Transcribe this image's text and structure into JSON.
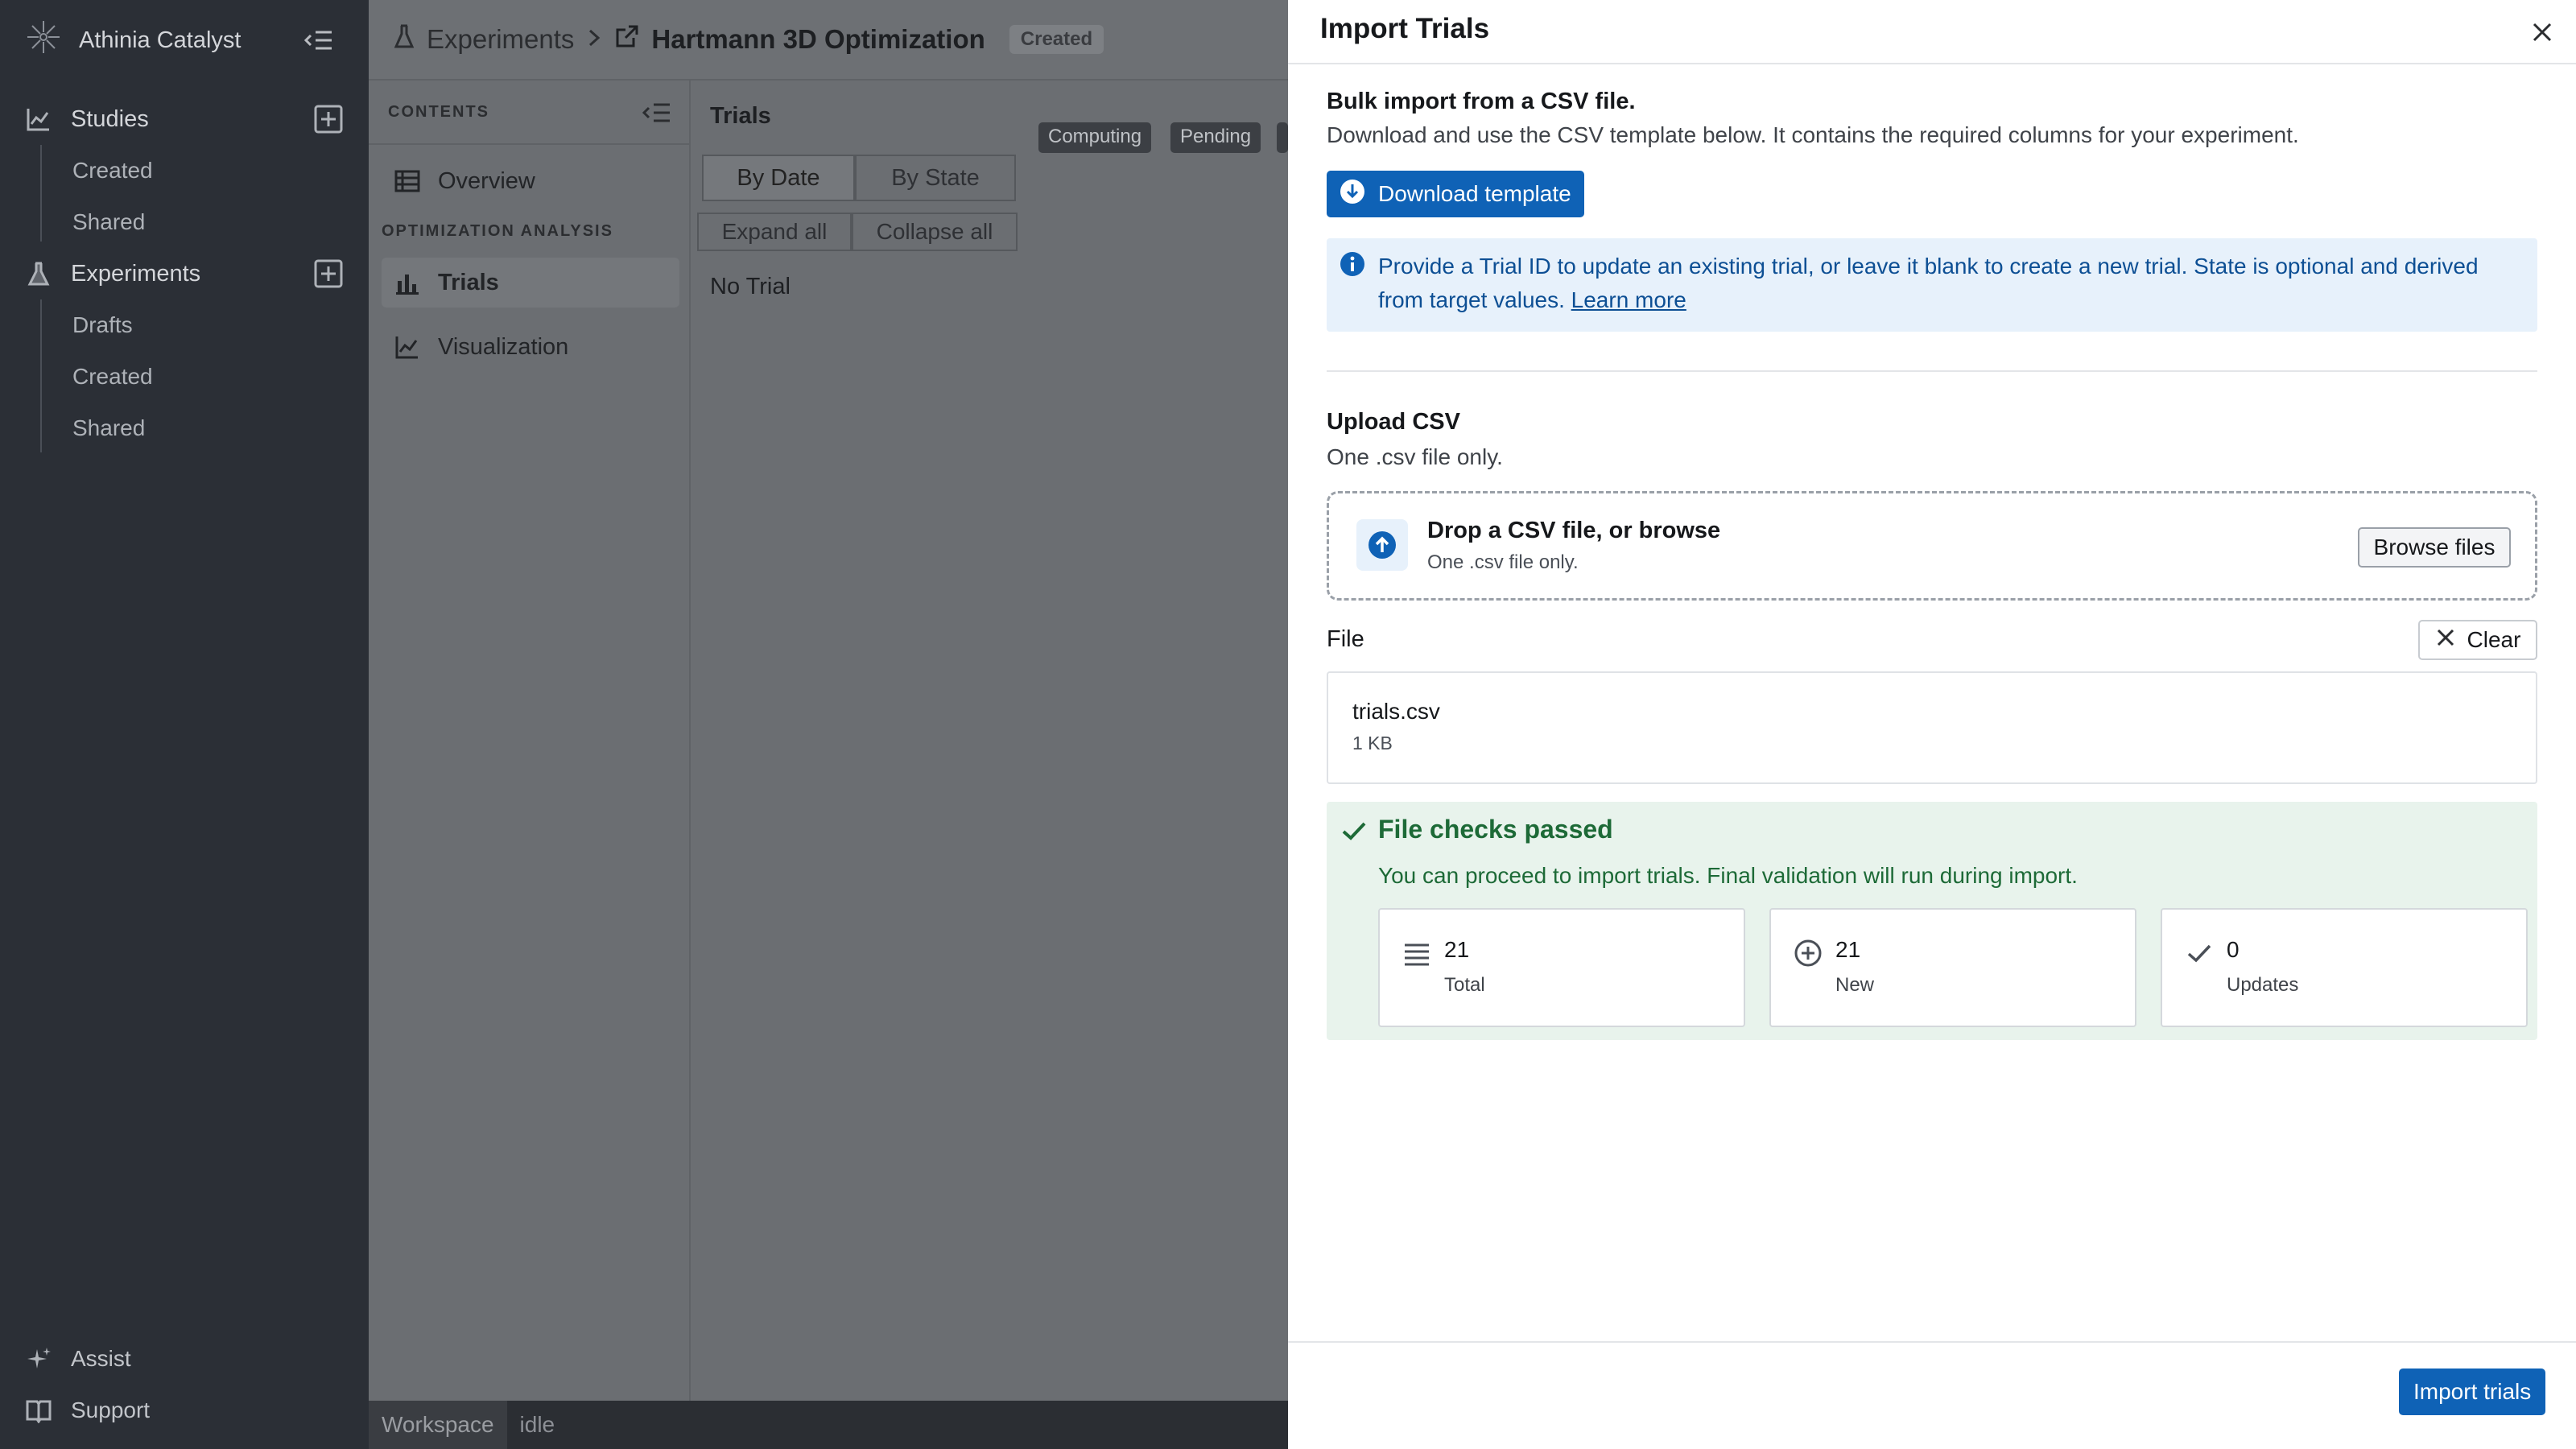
{
  "sidebar": {
    "brand": "Athinia Catalyst",
    "studies_label": "Studies",
    "studies_items": [
      "Created",
      "Shared"
    ],
    "experiments_label": "Experiments",
    "experiments_items": [
      "Drafts",
      "Created",
      "Shared"
    ],
    "assist_label": "Assist",
    "support_label": "Support"
  },
  "header": {
    "crumb_root": "Experiments",
    "crumb_current": "Hartmann 3D Optimization",
    "status_badge": "Created"
  },
  "contents": {
    "heading": "CONTENTS",
    "overview_label": "Overview",
    "group_label": "OPTIMIZATION ANALYSIS",
    "trials_label": "Trials",
    "visualization_label": "Visualization"
  },
  "trials_pane": {
    "title": "Trials",
    "state_badges": [
      "Computing",
      "Pending"
    ],
    "sort_tabs": [
      "By Date",
      "By State"
    ],
    "expand_label": "Expand all",
    "collapse_label": "Collapse all",
    "empty_text": "No Trial"
  },
  "statusbar": {
    "workspace": "Workspace",
    "state": "idle"
  },
  "drawer": {
    "title": "Import Trials",
    "bulk_title": "Bulk import from a CSV file.",
    "bulk_desc": "Download and use the CSV template below. It contains the required columns for your experiment.",
    "download_label": "Download template",
    "info_text": "Provide a Trial ID to update an existing trial, or leave it blank to create a new trial. State is optional and derived from target values.",
    "info_link": "Learn more",
    "upload_title": "Upload CSV",
    "upload_desc": "One .csv file only.",
    "drop_title": "Drop a CSV file, or browse",
    "drop_sub": "One .csv file only.",
    "browse_label": "Browse files",
    "file_label": "File",
    "clear_label": "Clear",
    "file_name": "trials.csv",
    "file_size": "1 KB",
    "checks_title": "File checks passed",
    "checks_desc": "You can proceed to import trials. Final validation will run during import.",
    "stats": [
      {
        "value": "21",
        "label": "Total",
        "icon": "list-icon"
      },
      {
        "value": "21",
        "label": "New",
        "icon": "plus-circle-icon"
      },
      {
        "value": "0",
        "label": "Updates",
        "icon": "check-icon"
      }
    ],
    "import_label": "Import trials"
  },
  "colors": {
    "primary": "#0f62b6",
    "success_bg": "#e8f3ec",
    "success_text": "#1d6a37",
    "info_bg": "#e7f1fb",
    "sidebar_bg": "#2b2f36"
  }
}
